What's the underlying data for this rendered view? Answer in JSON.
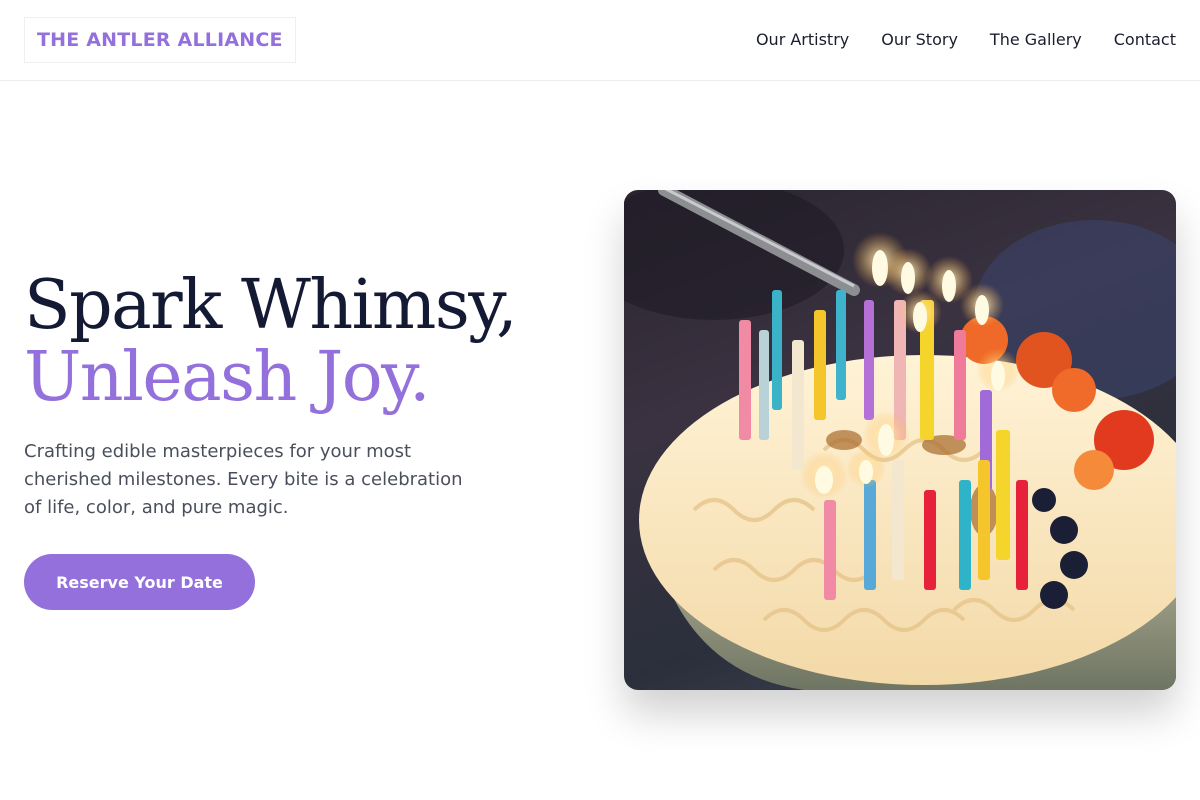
{
  "header": {
    "logo": "THE ANTLER ALLIANCE",
    "nav": [
      {
        "label": "Our Artistry"
      },
      {
        "label": "Our Story"
      },
      {
        "label": "The Gallery"
      },
      {
        "label": "Contact"
      }
    ]
  },
  "hero": {
    "title_line1": "Spark Whimsy,",
    "title_line2": "Unleash Joy.",
    "description": "Crafting edible masterpieces for your most cherished milestones. Every bite is a celebration of life, color, and pure magic.",
    "cta_label": "Reserve Your Date",
    "image_subject": "birthday-cake-with-lit-candles"
  },
  "colors": {
    "accent": "#9370db",
    "heading": "#141a33",
    "body_text": "#4a4f5c",
    "background": "#ffffff"
  }
}
